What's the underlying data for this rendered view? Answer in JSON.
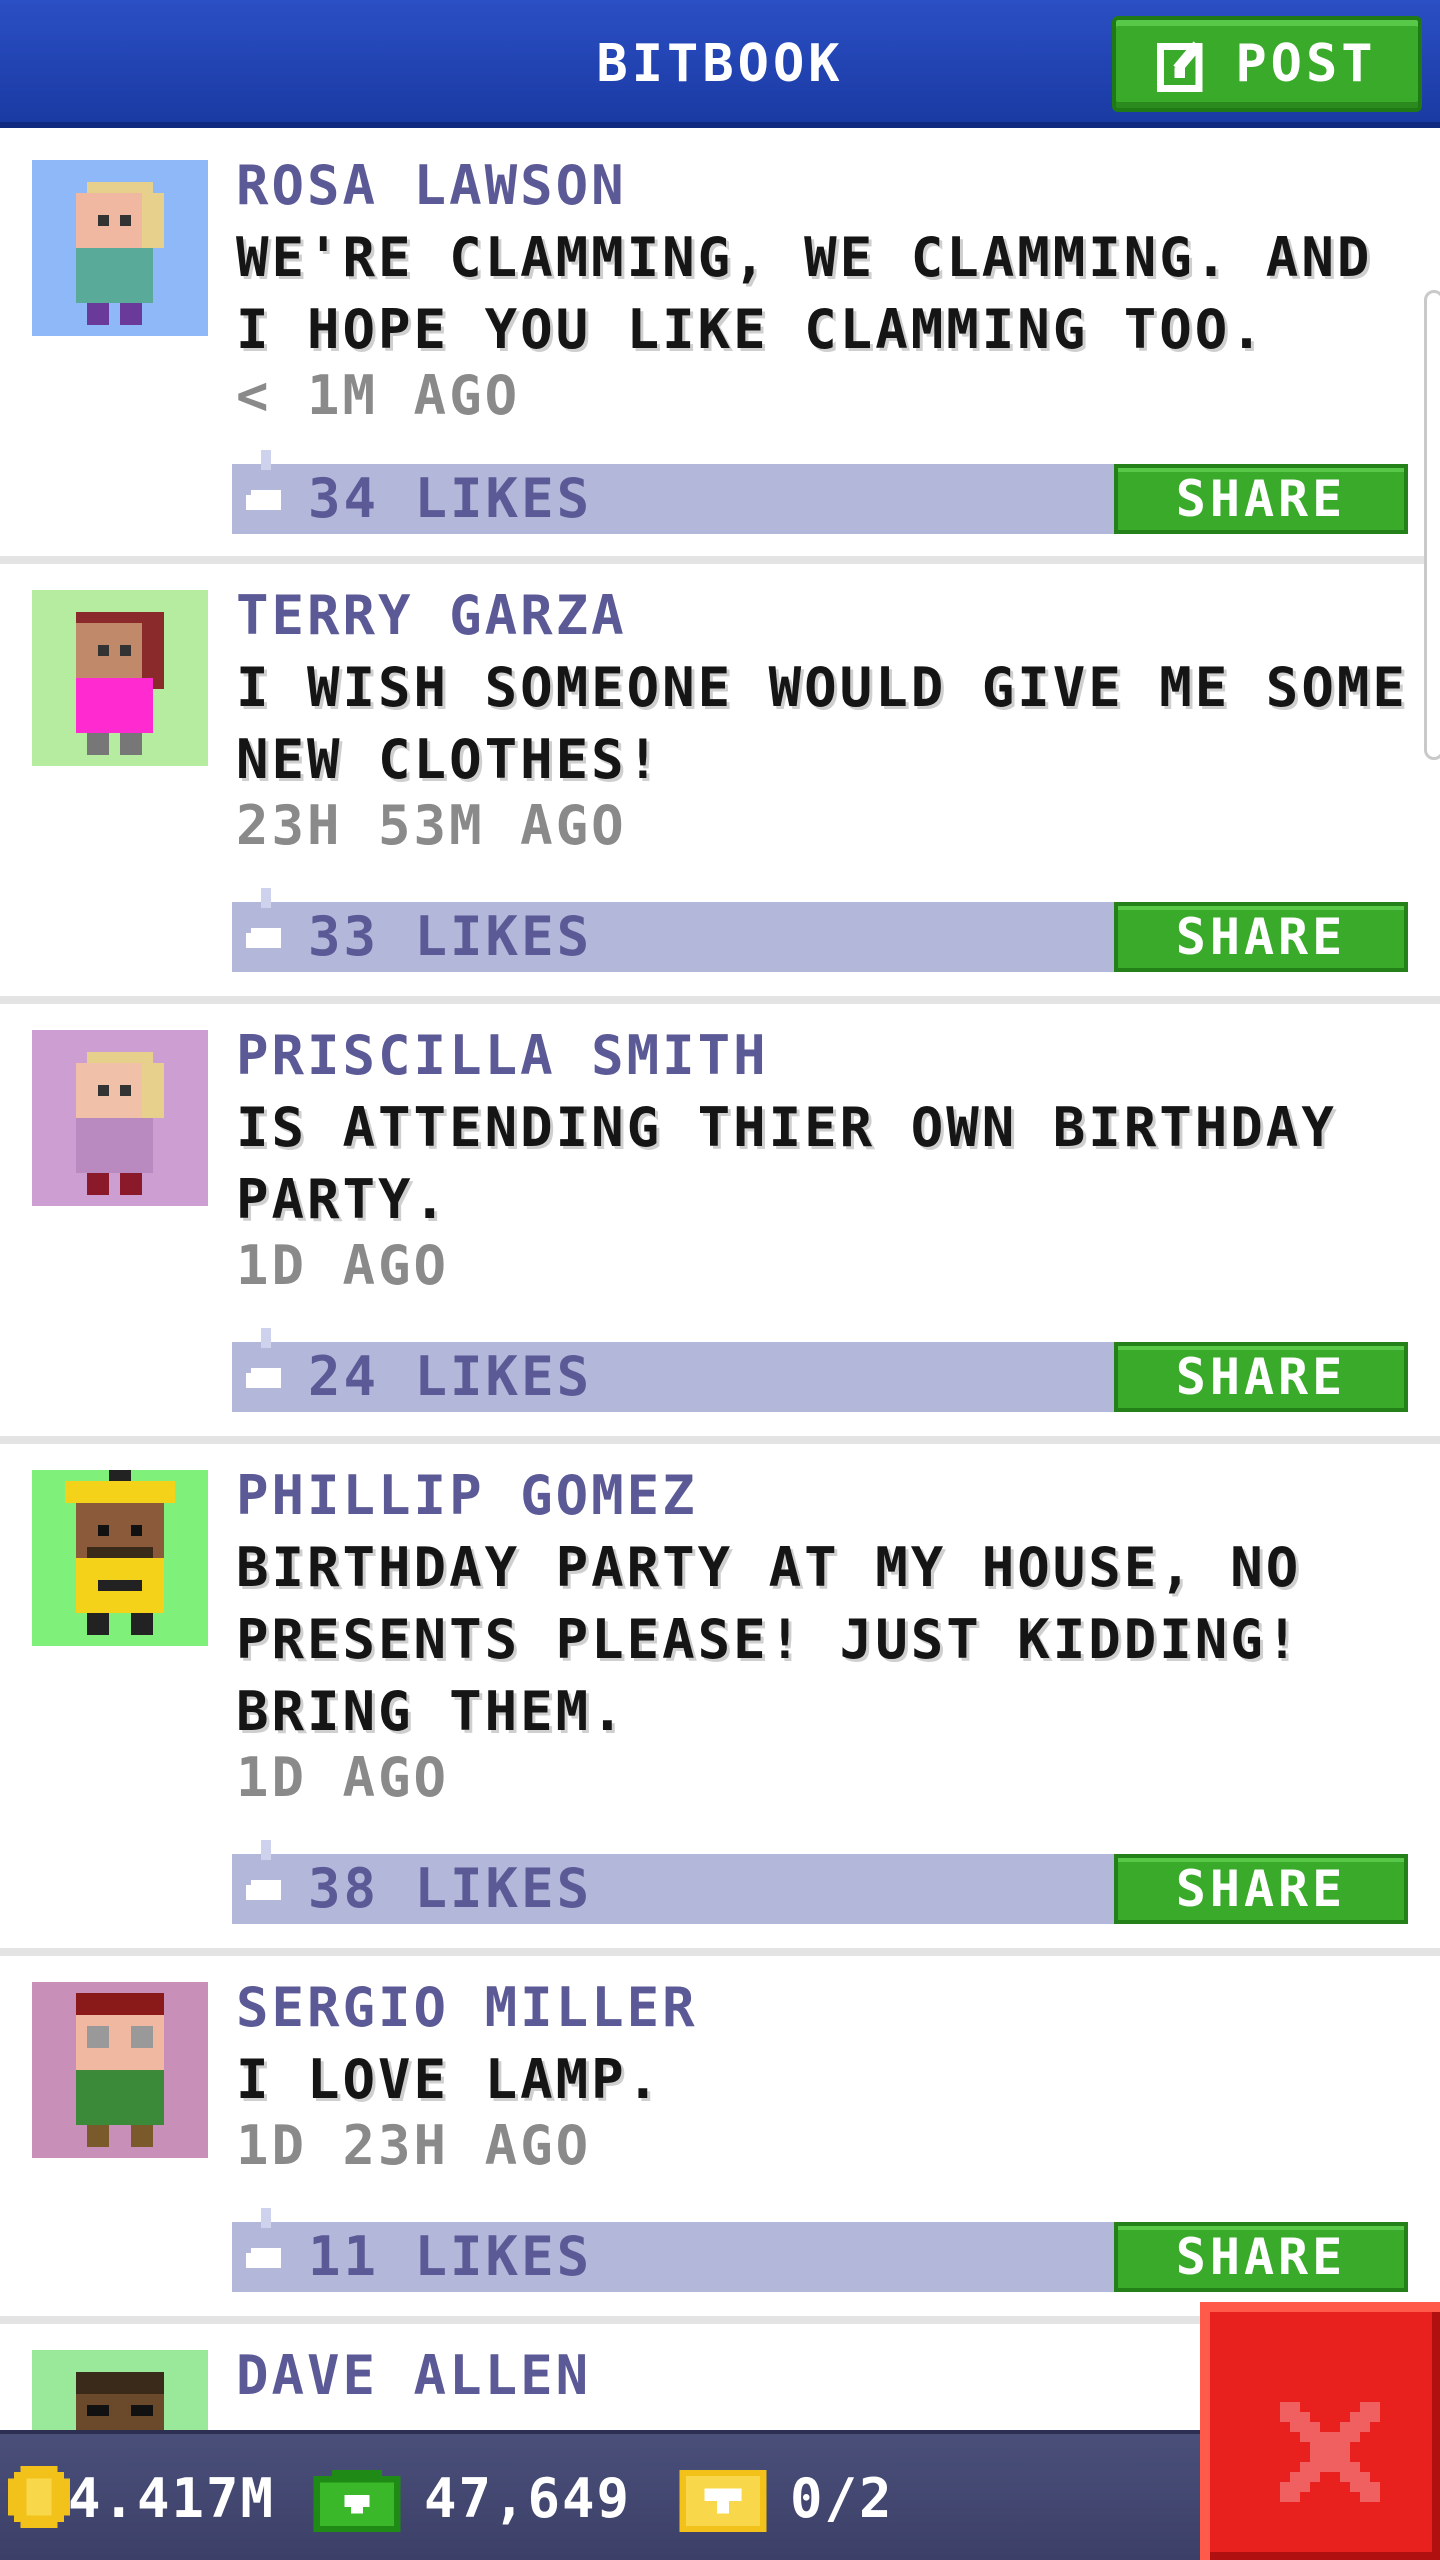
{
  "header": {
    "title": "BITBOOK",
    "post_label": "POST"
  },
  "posts": [
    {
      "author": "ROSA LAWSON",
      "text": "WE'RE CLAMMING, WE CLAMMING. AND I HOPE YOU LIKE CLAMMING TOO.",
      "time": "< 1M AGO",
      "likes": "34 LIKES",
      "share": "SHARE"
    },
    {
      "author": "TERRY GARZA",
      "text": "I WISH SOMEONE WOULD GIVE ME SOME NEW CLOTHES!",
      "time": "23H 53M AGO",
      "likes": "33 LIKES",
      "share": "SHARE"
    },
    {
      "author": "PRISCILLA SMITH",
      "text": "IS ATTENDING THIER OWN BIRTHDAY PARTY.",
      "time": "1D AGO",
      "likes": "24 LIKES",
      "share": "SHARE"
    },
    {
      "author": "PHILLIP GOMEZ",
      "text": "BIRTHDAY PARTY AT MY HOUSE, NO PRESENTS PLEASE! JUST KIDDING! BRING THEM.",
      "time": "1D AGO",
      "likes": "38 LIKES",
      "share": "SHARE"
    },
    {
      "author": "SERGIO MILLER",
      "text": "I LOVE LAMP.",
      "time": "1D 23H AGO",
      "likes": "11 LIKES",
      "share": "SHARE"
    },
    {
      "author": "DAVE ALLEN"
    }
  ],
  "status_bar": {
    "coins": "4.417M",
    "bux": "47,649",
    "tickets": "0/2"
  },
  "colors": {
    "header_blue": "#1a3aa3",
    "share_green": "#3aaa2a",
    "likes_bar": "#b3b7da",
    "close_red": "#e8201e"
  }
}
